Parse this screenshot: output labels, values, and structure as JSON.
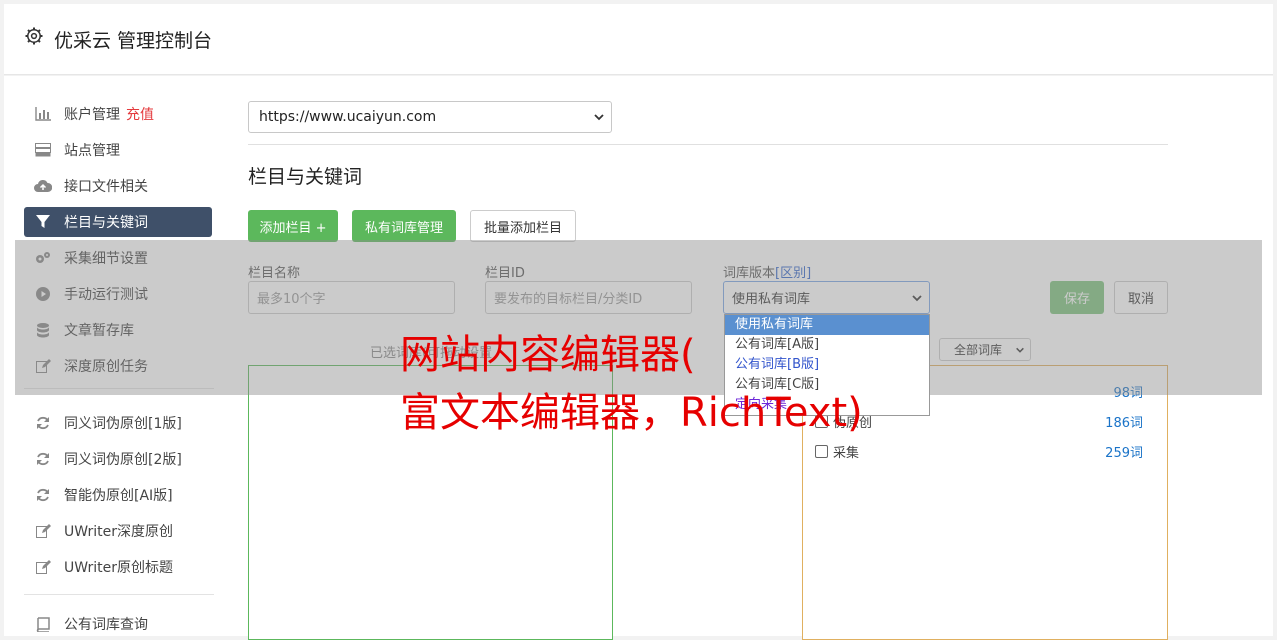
{
  "header": {
    "title": "优采云 管理控制台",
    "icon": "gear-icon"
  },
  "sidebar": {
    "items": [
      {
        "label": "账户管理",
        "extra": "充值",
        "icon": "bar-chart-icon"
      },
      {
        "label": "站点管理",
        "icon": "server-icon"
      },
      {
        "label": "接口文件相关",
        "icon": "cloud-upload-icon"
      },
      {
        "label": "栏目与关键词",
        "icon": "filter-icon",
        "active": true
      },
      {
        "label": "采集细节设置",
        "icon": "cogs-icon"
      },
      {
        "label": "手动运行测试",
        "icon": "play-circle-icon"
      },
      {
        "label": "文章暂存库",
        "icon": "database-icon"
      },
      {
        "label": "深度原创任务",
        "icon": "edit-icon"
      },
      {
        "label": "同义词伪原创[1版]",
        "icon": "refresh-icon"
      },
      {
        "label": "同义词伪原创[2版]",
        "icon": "refresh-icon"
      },
      {
        "label": "智能伪原创[AI版]",
        "icon": "refresh-icon"
      },
      {
        "label": "UWriter深度原创",
        "icon": "edit-icon"
      },
      {
        "label": "UWriter原创标题",
        "icon": "edit-icon"
      },
      {
        "label": "公有词库查询",
        "icon": "book-icon"
      }
    ]
  },
  "content": {
    "site_select": "https://www.ucaiyun.com",
    "section_title": "栏目与关键词",
    "buttons": {
      "add_column": "添加栏目 +",
      "private_lib": "私有词库管理",
      "batch_add": "批量添加栏目"
    },
    "form": {
      "name_label": "栏目名称",
      "name_placeholder": "最多10个字",
      "id_label": "栏目ID",
      "id_placeholder": "要发布的目标栏目/分类ID",
      "lib_label": "词库版本",
      "lib_label_link": "[区别]",
      "lib_selected": "使用私有词库",
      "save": "保存",
      "cancel": "取消"
    },
    "dropdown_options": [
      "使用私有词库",
      "公有词库[A版]",
      "公有词库[B版]",
      "公有词库[C版]",
      "定向采集"
    ],
    "selected_label": "已选词库(可拖动设置",
    "filter_select": "全部词库",
    "keywords": [
      {
        "name": "",
        "count": "98词"
      },
      {
        "name": "伪原创",
        "count": "186词"
      },
      {
        "name": "采集",
        "count": "259词"
      }
    ]
  },
  "watermark": {
    "line1": "网站内容编辑器(",
    "line2": "富文本编辑器，RichText)"
  },
  "colors": {
    "active_nav": "#3f5069",
    "green": "#5cb85c",
    "watermark": "#e60000",
    "link_blue": "#1a73c8"
  }
}
